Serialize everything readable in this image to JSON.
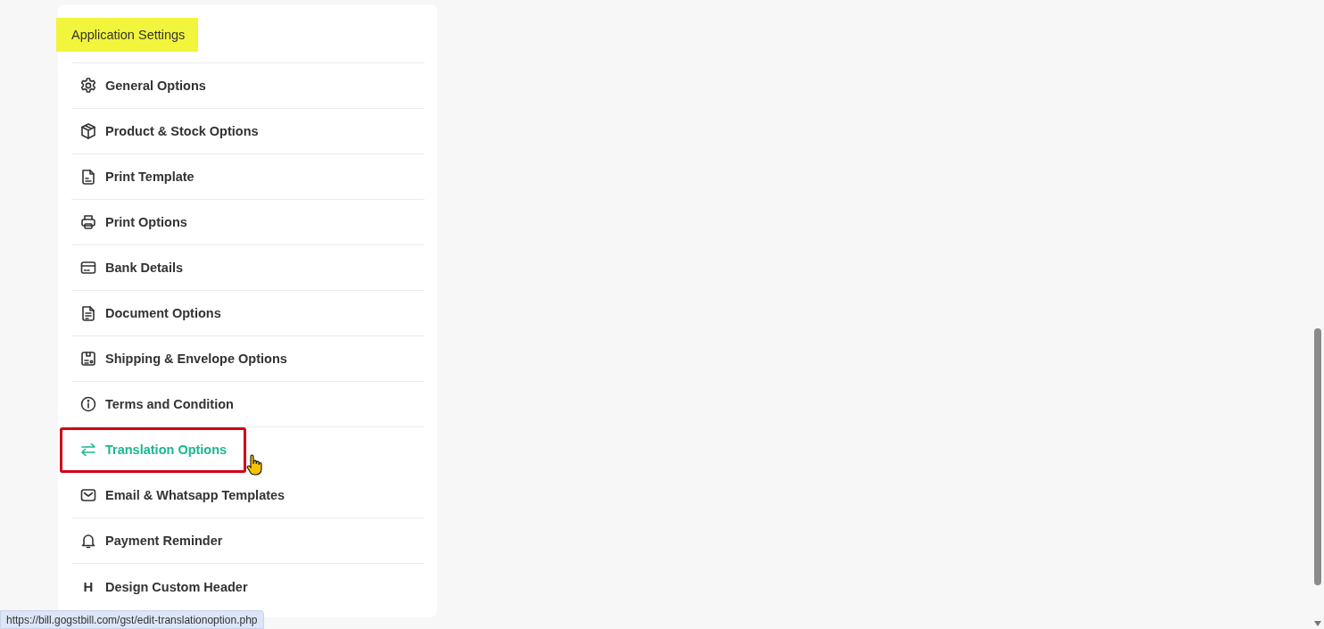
{
  "panel": {
    "heading": "Application Settings",
    "heading_highlighted": true,
    "items": [
      {
        "label": "General Options",
        "kind": "gear",
        "selected": false
      },
      {
        "label": "Product & Stock Options",
        "kind": "box",
        "selected": false
      },
      {
        "label": "Print Template",
        "kind": "template",
        "selected": false
      },
      {
        "label": "Print Options",
        "kind": "printer",
        "selected": false
      },
      {
        "label": "Bank Details",
        "kind": "card",
        "selected": false
      },
      {
        "label": "Document Options",
        "kind": "document",
        "selected": false
      },
      {
        "label": "Shipping & Envelope Options",
        "kind": "shipping",
        "selected": false
      },
      {
        "label": "Terms and Condition",
        "kind": "info",
        "selected": false
      },
      {
        "label": "Translation Options",
        "kind": "swap",
        "selected": true
      },
      {
        "label": "Email & Whatsapp Templates",
        "kind": "mail",
        "selected": false
      },
      {
        "label": "Payment Reminder",
        "kind": "bell",
        "selected": false
      },
      {
        "label": "Design Custom Header",
        "kind": "glyph",
        "glyph": "H",
        "selected": false
      }
    ]
  },
  "status_bar": {
    "url": "https://bill.gogstbill.com/gst/edit-translationoption.php"
  }
}
